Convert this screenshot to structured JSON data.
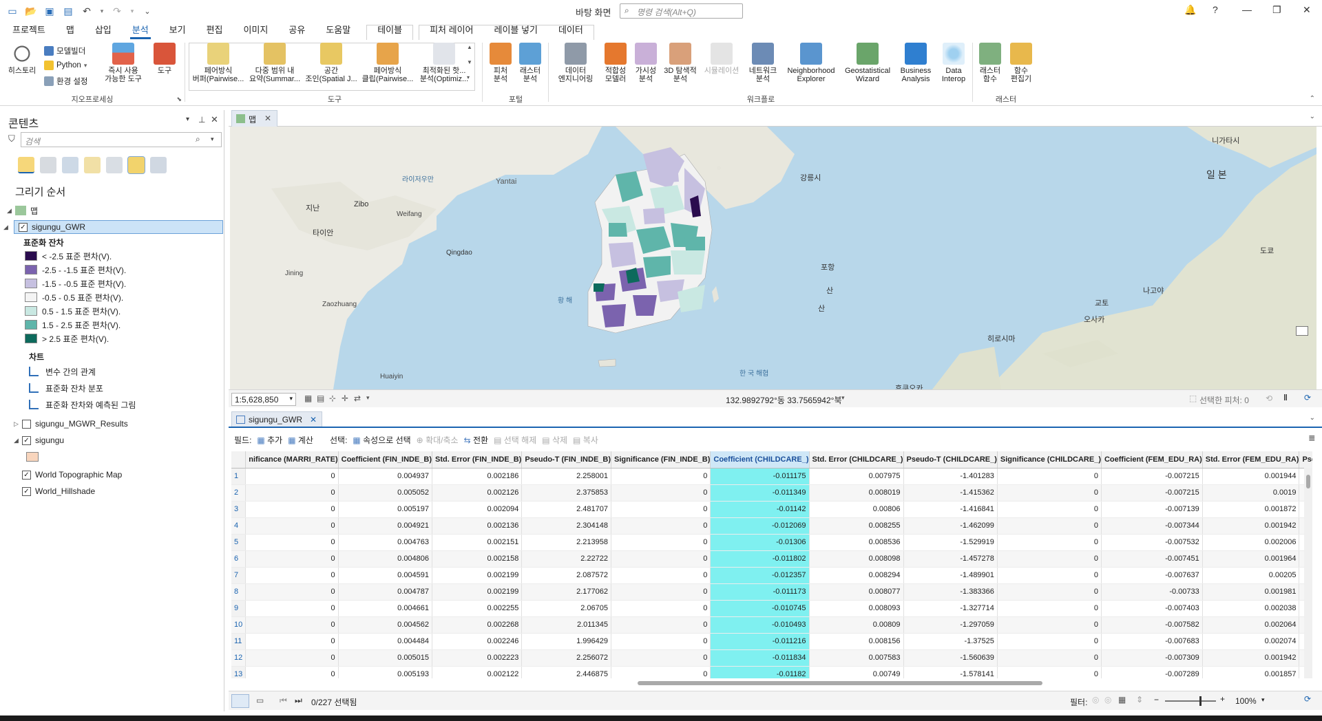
{
  "window": {
    "title": "바탕 화면",
    "search_placeholder": "명령 검색(Alt+Q)"
  },
  "tabs": [
    {
      "label": "프로젝트"
    },
    {
      "label": "맵"
    },
    {
      "label": "삽입"
    },
    {
      "label": "분석",
      "active": true
    },
    {
      "label": "보기"
    },
    {
      "label": "편집"
    },
    {
      "label": "이미지"
    },
    {
      "label": "공유"
    },
    {
      "label": "도움말"
    }
  ],
  "context_tabs": {
    "table": "테이블",
    "feature_layer": "피처 레이어",
    "labeling": "레이블 넣기",
    "data": "데이터"
  },
  "ribbon": {
    "geoprocessing": {
      "label": "지오프로세싱",
      "history": "히스토리",
      "modelbuilder": "모델빌더",
      "python": "Python",
      "env": "환경 설정",
      "ready_tools": "즉시 사용\n가능한 도구",
      "tools": "도구"
    },
    "tools_group": {
      "label": "도구",
      "items": [
        "페어방식\n버퍼(Pairwise...",
        "다중 범위 내\n요약(Summar...",
        "공간\n조인(Spatial J...",
        "페어방식\n클립(Pairwise...",
        "최적화된 핫...\n분석(Optimiz..."
      ]
    },
    "portal": {
      "label": "포털",
      "feature_analysis": "피처\n분석",
      "raster_analysis": "래스터\n분석"
    },
    "workflow": {
      "label": "워크플로",
      "items": [
        "데이터\n엔지니어링",
        "적합성\n모델러",
        "가시성\n분석",
        "3D 탐색적\n분석",
        "시뮬레이션",
        "네트워크\n분석",
        "Neighborhood\nExplorer",
        "Geostatistical\nWizard",
        "Business\nAnalysis",
        "Data\nInterop"
      ]
    },
    "raster": {
      "label": "래스터",
      "raster_functions": "래스터\n함수",
      "function_editor": "함수\n편집기"
    }
  },
  "contents": {
    "title": "콘텐츠",
    "search_placeholder": "검색",
    "draw_order": "그리기 순서",
    "map_name": "맵",
    "layer_gwr": "sigungu_GWR",
    "legend_title": "표준화 잔차",
    "legend": [
      {
        "label": "< -2.5 표준 편차(V).",
        "color": "#2a0c4e"
      },
      {
        "label": "-2.5 - -1.5 표준 편차(V).",
        "color": "#7b63ae"
      },
      {
        "label": "-1.5 - -0.5 표준 편차(V).",
        "color": "#c6c0e0"
      },
      {
        "label": "-0.5 - 0.5 표준 편차(V).",
        "color": "#f4f4f4"
      },
      {
        "label": "0.5 - 1.5 표준 편차(V).",
        "color": "#c9e8e2"
      },
      {
        "label": "1.5 - 2.5 표준 편차(V).",
        "color": "#5fb5aa"
      },
      {
        "label": "> 2.5 표준 편차(V).",
        "color": "#0d6a5c"
      }
    ],
    "charts_label": "차트",
    "charts": [
      "변수 간의 관계",
      "표준화 잔차 분포",
      "표준화 잔차와 예측된 그림"
    ],
    "layer_mgwr": "sigungu_MGWR_Results",
    "layer_sigungu": "sigungu",
    "sigungu_color": "#f8d5bd",
    "layer_topo": "World Topographic Map",
    "layer_hillshade": "World_Hillshade"
  },
  "map": {
    "tab": "맵",
    "labels": [
      "라이저우만",
      "Yantai",
      "지난",
      "Zibo",
      "Weifang",
      "타이안",
      "Qingdao",
      "Jining",
      "Zaozhuang",
      "황 해",
      "Huaiyin",
      "강릉시",
      "포항",
      "산",
      "산",
      "한 국 해협",
      "니가타시",
      "일 본",
      "도쿄",
      "나고야",
      "교토",
      "오사카",
      "히로시마",
      "후쿠오카"
    ],
    "scale": "1:5,628,850",
    "coords": "132.9892792°동 33.7565942°북",
    "selected_features": "선택한 피처: 0"
  },
  "table": {
    "tab": "sigungu_GWR",
    "toolbar": {
      "field": "필드:",
      "add": "추가",
      "calc": "계산",
      "selection": "선택:",
      "select_by_attr": "속성으로 선택",
      "zoom": "확대/축소",
      "switch": "전환",
      "clear": "선택 해제",
      "delete": "삭제",
      "copy": "복사"
    },
    "columns": [
      "nificance (MARRI_RATE)",
      "Coefficient (FIN_INDE_B)",
      "Std. Error (FIN_INDE_B)",
      "Pseudo-T (FIN_INDE_B)",
      "Significance (FIN_INDE_B)",
      "Coefficient (CHILDCARE_)",
      "Std. Error (CHILDCARE_)",
      "Pseudo-T (CHILDCARE_)",
      "Significance (CHILDCARE_)",
      "Coefficient (FEM_EDU_RA)",
      "Std. Error (FEM_EDU_RA)",
      "Pseu"
    ],
    "rows": [
      [
        "1",
        "0",
        "0.004937",
        "0.002186",
        "2.258001",
        "0",
        "-0.011175",
        "0.007975",
        "-1.401283",
        "0",
        "-0.007215",
        "0.001944"
      ],
      [
        "2",
        "0",
        "0.005052",
        "0.002126",
        "2.375853",
        "0",
        "-0.011349",
        "0.008019",
        "-1.415362",
        "0",
        "-0.007215",
        "0.0019"
      ],
      [
        "3",
        "0",
        "0.005197",
        "0.002094",
        "2.481707",
        "0",
        "-0.01142",
        "0.00806",
        "-1.416841",
        "0",
        "-0.007139",
        "0.001872"
      ],
      [
        "4",
        "0",
        "0.004921",
        "0.002136",
        "2.304148",
        "0",
        "-0.012069",
        "0.008255",
        "-1.462099",
        "0",
        "-0.007344",
        "0.001942"
      ],
      [
        "5",
        "0",
        "0.004763",
        "0.002151",
        "2.213958",
        "0",
        "-0.01306",
        "0.008536",
        "-1.529919",
        "0",
        "-0.007532",
        "0.002006"
      ],
      [
        "6",
        "0",
        "0.004806",
        "0.002158",
        "2.22722",
        "0",
        "-0.011802",
        "0.008098",
        "-1.457278",
        "0",
        "-0.007451",
        "0.001964"
      ],
      [
        "7",
        "0",
        "0.004591",
        "0.002199",
        "2.087572",
        "0",
        "-0.012357",
        "0.008294",
        "-1.489901",
        "0",
        "-0.007637",
        "0.00205"
      ],
      [
        "8",
        "0",
        "0.004787",
        "0.002199",
        "2.177062",
        "0",
        "-0.011173",
        "0.008077",
        "-1.383366",
        "0",
        "-0.00733",
        "0.001981"
      ],
      [
        "9",
        "0",
        "0.004661",
        "0.002255",
        "2.06705",
        "0",
        "-0.010745",
        "0.008093",
        "-1.327714",
        "0",
        "-0.007403",
        "0.002038"
      ],
      [
        "10",
        "0",
        "0.004562",
        "0.002268",
        "2.011345",
        "0",
        "-0.010493",
        "0.00809",
        "-1.297059",
        "0",
        "-0.007582",
        "0.002064"
      ],
      [
        "11",
        "0",
        "0.004484",
        "0.002246",
        "1.996429",
        "0",
        "-0.011216",
        "0.008156",
        "-1.37525",
        "0",
        "-0.007683",
        "0.002074"
      ],
      [
        "12",
        "0",
        "0.005015",
        "0.002223",
        "2.256072",
        "0",
        "-0.011834",
        "0.007583",
        "-1.560639",
        "0",
        "-0.007309",
        "0.001942"
      ],
      [
        "13",
        "0",
        "0.005193",
        "0.002122",
        "2.446875",
        "0",
        "-0.01182",
        "0.00749",
        "-1.578141",
        "0",
        "-0.007289",
        "0.001857"
      ]
    ],
    "selection_count": "0/227 선택됨",
    "filter_label": "필터:",
    "zoom": "100%"
  },
  "colors": {
    "accent": "#1a63b0",
    "highlight": "#7ff0f0"
  }
}
